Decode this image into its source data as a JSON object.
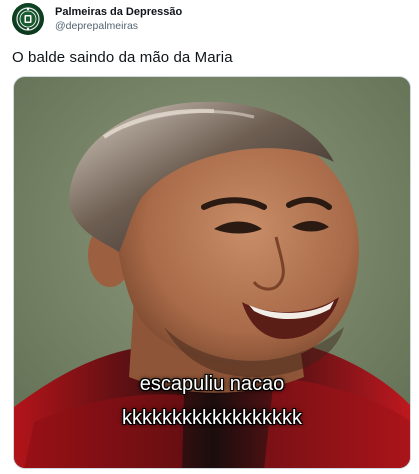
{
  "tweet": {
    "display_name": "Palmeiras da Depressão",
    "handle": "@deprepalmeiras",
    "text": "O balde saindo da mão da Maria",
    "avatar_icon": "palmeiras-crest-icon",
    "accent_color": "#1f6b3a"
  },
  "media": {
    "caption_line1": "escapuliu nacao",
    "caption_line2": "kkkkkkkkkkkkkkkkkk"
  }
}
